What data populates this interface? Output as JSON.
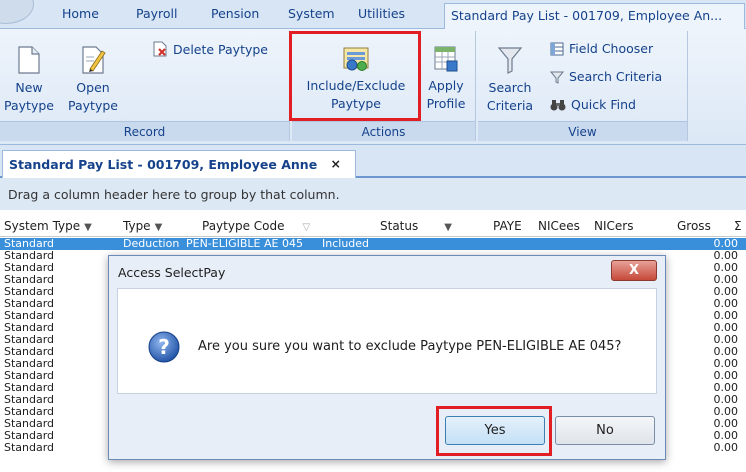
{
  "ribbon_tabs": [
    "Home",
    "Payroll",
    "Pension",
    "System",
    "Utilities",
    "Standard Pay List - 001709, Employee An..."
  ],
  "record_group": {
    "label": "Record",
    "new_line1": "New",
    "new_line2": "Paytype",
    "open_line1": "Open",
    "open_line2": "Paytype",
    "delete": "Delete Paytype"
  },
  "actions_group": {
    "label": "Actions",
    "include_line1": "Include/Exclude",
    "include_line2": "Paytype",
    "apply_line1": "Apply",
    "apply_line2": "Profile"
  },
  "view_group": {
    "label": "View",
    "search_line1": "Search",
    "search_line2": "Criteria",
    "field_chooser": "Field Chooser",
    "search_criteria": "Search Criteria",
    "quick_find": "Quick Find"
  },
  "doc_tab": {
    "title": "Standard Pay List - 001709, Employee Anne",
    "close": "×"
  },
  "group_hint": "Drag a column header here to group by that column.",
  "columns": [
    "System Type",
    "Type",
    "Paytype Code",
    "Status",
    "PAYE",
    "NICees",
    "NICers",
    "Gross",
    "Σ"
  ],
  "selected_row": {
    "system_type": "Standard",
    "type": "Deduction",
    "code": "PEN-ELIGIBLE AE 045",
    "status": "Included",
    "value": "0.00"
  },
  "rows": [
    {
      "system_type": "Standard",
      "value": "0.00"
    },
    {
      "system_type": "Standard",
      "value": "0.00"
    },
    {
      "system_type": "Standard",
      "value": "0.00"
    },
    {
      "system_type": "Standard",
      "value": "0.00"
    },
    {
      "system_type": "Standard",
      "value": "0.00"
    },
    {
      "system_type": "Standard",
      "value": "0.00"
    },
    {
      "system_type": "Standard",
      "value": "0.00"
    },
    {
      "system_type": "Standard",
      "value": "0.00"
    },
    {
      "system_type": "Standard",
      "value": "0.00"
    },
    {
      "system_type": "Standard",
      "value": "0.00"
    },
    {
      "system_type": "Standard",
      "value": "0.00"
    },
    {
      "system_type": "Standard",
      "value": "0.00"
    },
    {
      "system_type": "Standard",
      "value": "0.00"
    },
    {
      "system_type": "Standard",
      "value": "0.00"
    },
    {
      "system_type": "Standard",
      "value": "0.00"
    },
    {
      "system_type": "Standard",
      "value": "0.00"
    },
    {
      "system_type": "Standard",
      "value": "0.00"
    }
  ],
  "dialog": {
    "title": "Access SelectPay",
    "close": "X",
    "message": "Are you sure you want to exclude Paytype PEN-ELIGIBLE AE 045?",
    "yes": "Yes",
    "no": "No",
    "icon_glyph": "?"
  },
  "colors": {
    "highlight": "#e01e24",
    "selection": "#3a8fdb",
    "ribbon_text": "#15428b"
  }
}
